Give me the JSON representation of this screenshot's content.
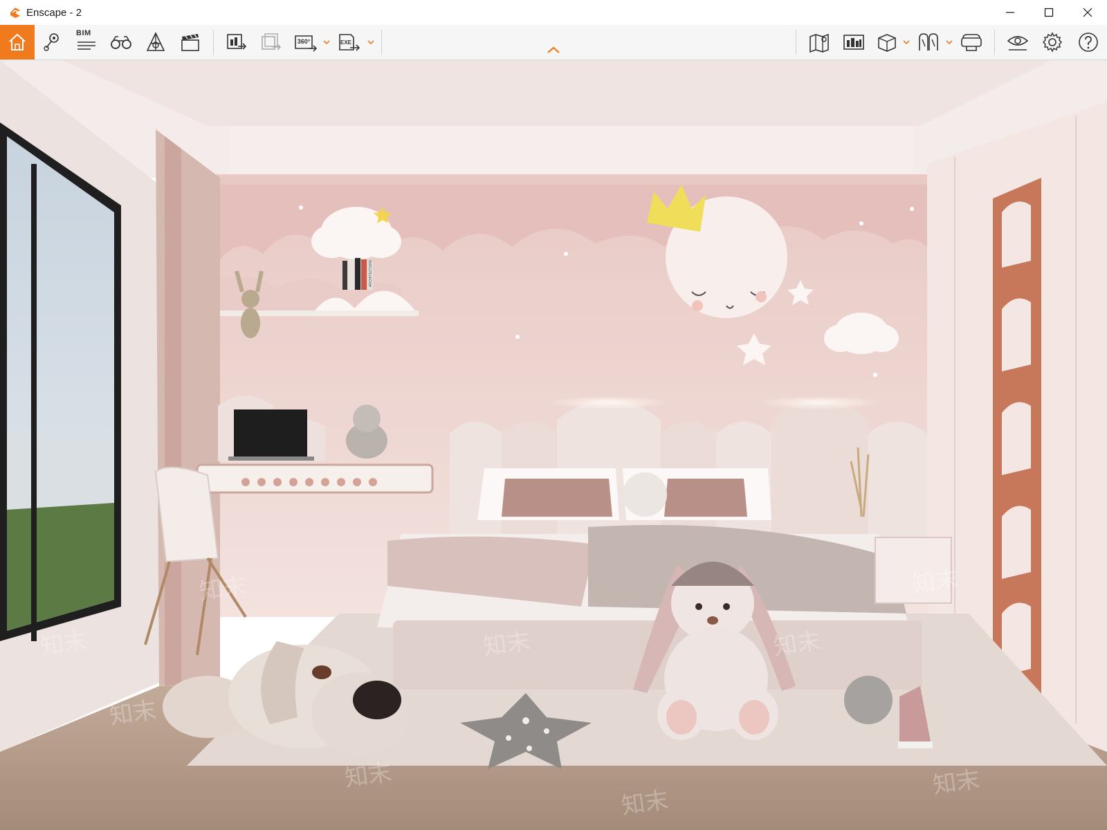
{
  "window": {
    "title": "Enscape - 2"
  },
  "window_controls": {
    "minimize_icon": "minimize-icon",
    "maximize_icon": "maximize-icon",
    "close_icon": "close-icon"
  },
  "toolbar": {
    "left_tools": [
      {
        "id": "home",
        "icon": "home-icon",
        "active": true
      },
      {
        "id": "location",
        "icon": "location-pin-icon"
      },
      {
        "id": "bim",
        "icon": "bim-icon",
        "label": "BIM"
      },
      {
        "id": "binoculars",
        "icon": "binoculars-icon"
      },
      {
        "id": "assets",
        "icon": "asset-library-icon"
      },
      {
        "id": "video",
        "icon": "video-editor-icon"
      },
      {
        "id": "render",
        "icon": "render-image-icon"
      },
      {
        "id": "batch",
        "icon": "batch-render-icon"
      },
      {
        "id": "pano",
        "icon": "panorama-360-icon",
        "label": "360°"
      },
      {
        "id": "exe",
        "icon": "export-exe-icon",
        "label": "EXE"
      }
    ],
    "right_tools": [
      {
        "id": "map",
        "icon": "map-icon"
      },
      {
        "id": "site-context",
        "icon": "site-context-icon"
      },
      {
        "id": "box",
        "icon": "cube-icon"
      },
      {
        "id": "views",
        "icon": "views-icon"
      },
      {
        "id": "vr",
        "icon": "vr-headset-icon"
      },
      {
        "id": "visual-settings",
        "icon": "eye-icon"
      },
      {
        "id": "settings",
        "icon": "gear-icon"
      },
      {
        "id": "help",
        "icon": "help-icon"
      }
    ],
    "accent_color": "#f07a1e"
  },
  "viewport": {
    "scene": "kids-bedroom-render",
    "book_labels": [
      "ARCHITECTURE"
    ],
    "watermark_text": "知末",
    "wall_color": "#efd5d1",
    "floor_color": "#b79e8c"
  }
}
